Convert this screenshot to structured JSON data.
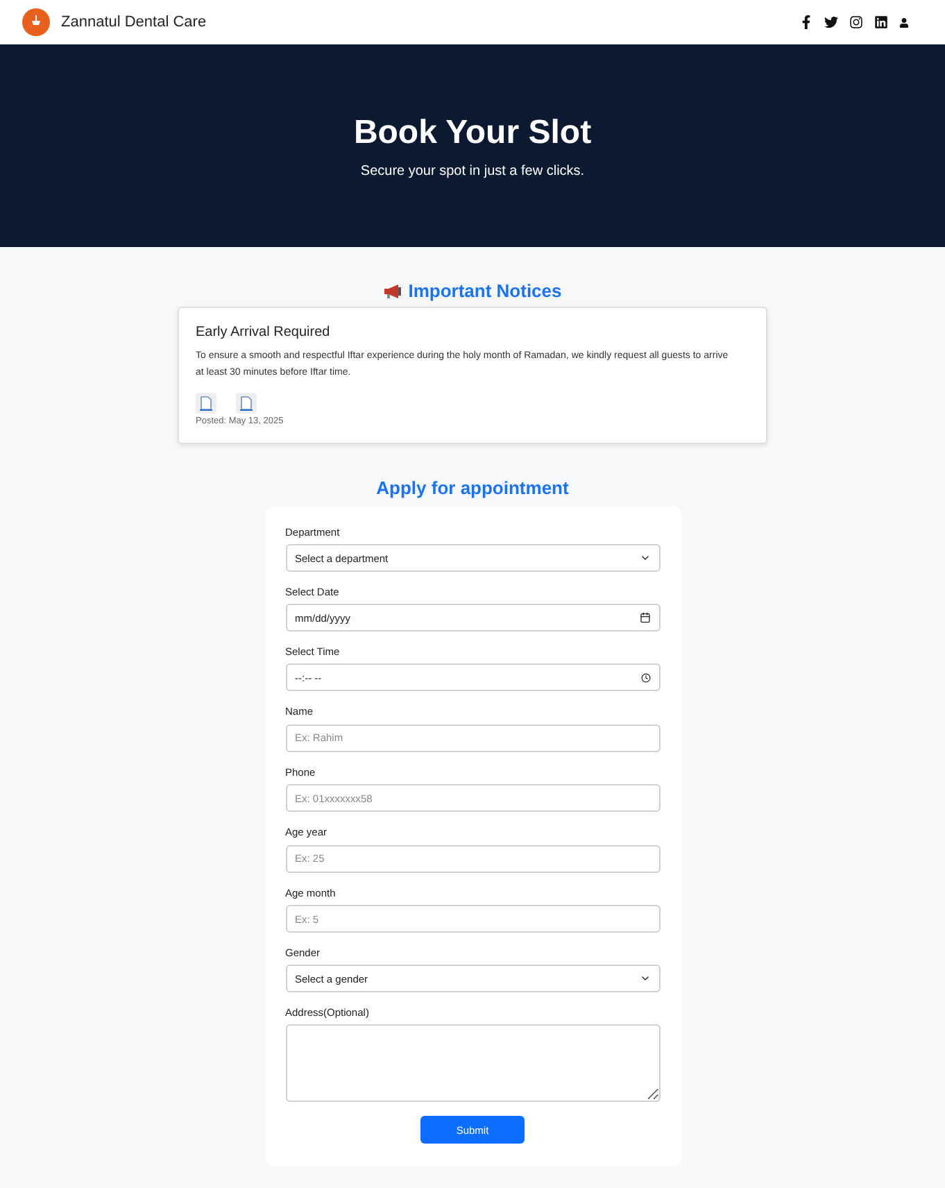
{
  "header": {
    "brand": "Zannatul Dental Care"
  },
  "hero": {
    "title": "Book Your Slot",
    "subtitle": "Secure your spot in just a few clicks."
  },
  "notices": {
    "title": "Important Notices",
    "items": [
      {
        "title": "Early Arrival Required",
        "body": "To ensure a smooth and respectful Iftar experience during the holy month of Ramadan, we kindly request all guests to arrive at least 30 minutes before Iftar time.",
        "attachments": [
          {
            "kind": "document"
          },
          {
            "kind": "document"
          }
        ],
        "posted": "Posted: May 13, 2025"
      }
    ]
  },
  "form": {
    "title": "Apply for appointment",
    "fields": [
      {
        "kind": "select",
        "label": "Department",
        "value": "Select a department"
      },
      {
        "kind": "date",
        "label": "Select Date",
        "value": "mm/dd/yyyy"
      },
      {
        "kind": "time",
        "label": "Select Time",
        "value": "--:-- --"
      },
      {
        "kind": "text",
        "label": "Name",
        "placeholder": "Ex: Rahim"
      },
      {
        "kind": "text",
        "label": "Phone",
        "placeholder": "Ex: 01xxxxxxx58"
      },
      {
        "kind": "text",
        "label": "Age year",
        "placeholder": "Ex: 25"
      },
      {
        "kind": "text",
        "label": "Age month",
        "placeholder": "Ex: 5"
      },
      {
        "kind": "select",
        "label": "Gender",
        "value": "Select a gender"
      },
      {
        "kind": "textarea",
        "label": "Address(Optional)"
      }
    ],
    "submit": "Submit"
  }
}
